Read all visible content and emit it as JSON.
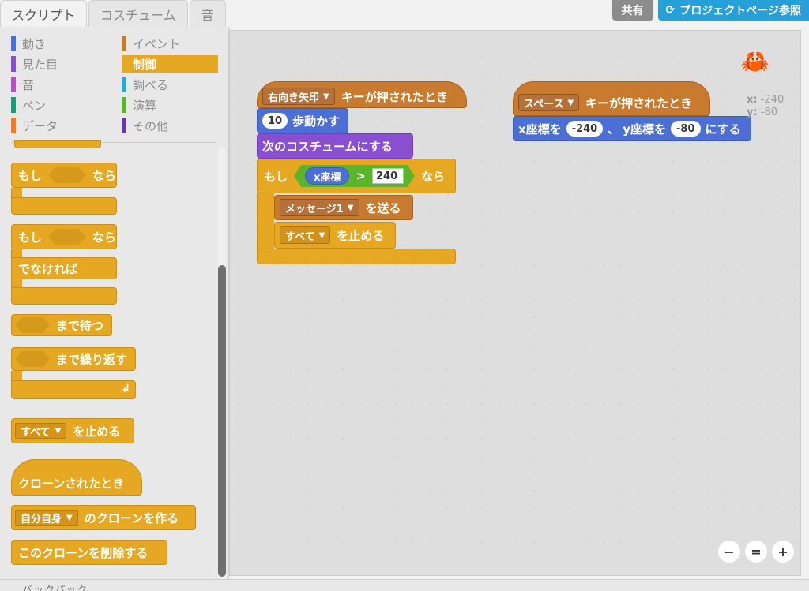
{
  "tabs": [
    {
      "label": "スクリプト",
      "active": true
    },
    {
      "label": "コスチューム",
      "active": false
    },
    {
      "label": "音",
      "active": false
    }
  ],
  "topbar": {
    "share_label": "共有",
    "project_page_label": "プロジェクトページ参照"
  },
  "categories": {
    "left": [
      {
        "label": "動き",
        "color": "#4c6fd6"
      },
      {
        "label": "見た目",
        "color": "#8a4fd1"
      },
      {
        "label": "音",
        "color": "#b94fc6"
      },
      {
        "label": "ペン",
        "color": "#149e7c"
      },
      {
        "label": "データ",
        "color": "#f47c20"
      }
    ],
    "right": [
      {
        "label": "イベント",
        "color": "#c87a2e"
      },
      {
        "label": "制御",
        "color": "#e6a822",
        "active": true
      },
      {
        "label": "調べる",
        "color": "#2aa8d9"
      },
      {
        "label": "演算",
        "color": "#5ab52b"
      },
      {
        "label": "その他",
        "color": "#6a3aa0"
      }
    ]
  },
  "palette_blocks": {
    "if_then_1": {
      "if": "もし",
      "then": "なら"
    },
    "if_else": {
      "if": "もし",
      "then": "なら",
      "else": "でなければ"
    },
    "wait_until": {
      "label": "まで待つ"
    },
    "repeat_until": {
      "label": "まで繰り返す"
    },
    "stop": {
      "dropdown": "すべて",
      "label": "を止める"
    },
    "when_clone": {
      "label": "クローンされたとき"
    },
    "create_clone": {
      "dropdown": "自分自身",
      "label": "のクローンを作る"
    },
    "delete_clone": {
      "label": "このクローンを削除する"
    }
  },
  "script1": {
    "hat_dropdown": "右向き矢印",
    "hat_label": "キーが押されたとき",
    "move_value": "10",
    "move_label": "歩動かす",
    "costume_label": "次のコスチュームにする",
    "if_label": "もし",
    "var_label": "x座標",
    "op": ">",
    "compare_value": "240",
    "then_label": "なら",
    "broadcast_dropdown": "メッセージ1",
    "broadcast_label": "を送る",
    "stop_dropdown": "すべて",
    "stop_label": "を止める"
  },
  "script2": {
    "hat_dropdown": "スペース",
    "hat_label": "キーが押されたとき",
    "goto_x_label": "x座標を",
    "x_value": "-240",
    "sep": "、",
    "goto_y_label": "y座標を",
    "y_value": "-80",
    "goto_end": "にする"
  },
  "sprite_info": {
    "x_label": "x:",
    "x_value": "-240",
    "y_label": "y:",
    "y_value": "-80"
  },
  "zoom": {
    "out_icon": "zoom-out-icon",
    "reset_icon": "zoom-reset-icon",
    "in_icon": "zoom-in-icon"
  },
  "backpack": {
    "label": "バックパック"
  }
}
